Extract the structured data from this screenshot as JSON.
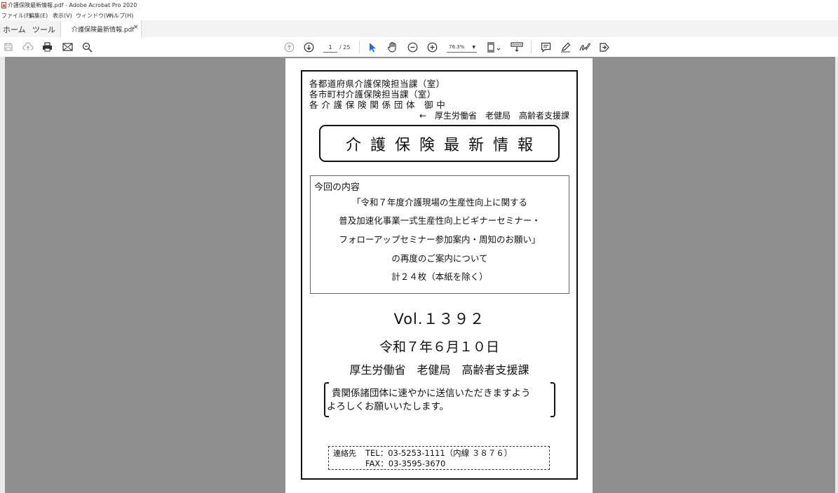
{
  "window": {
    "title": "介護保険最新情報.pdf - Adobe Acrobat Pro 2020"
  },
  "menu": [
    "ファイル(F)",
    "編集(E)",
    "表示(V)",
    "ウィンドウ(W)",
    "ヘルプ(H)"
  ],
  "tabs": {
    "home": "ホーム",
    "tools": "ツール",
    "document": "介護保険最新情報.pdf",
    "close": "×"
  },
  "toolbar": {
    "icons": [
      "save-icon",
      "upload-icon",
      "print-icon",
      "mail-icon",
      "zoom-search-icon",
      "prev-page-icon",
      "next-page-icon",
      "select-cursor-icon",
      "hand-icon",
      "zoom-out-icon",
      "zoom-in-icon",
      "fit-page-icon",
      "scroll-mode-icon",
      "comment-icon",
      "pen-icon",
      "sign-icon",
      "share-icon"
    ],
    "current_page": "1",
    "total_pages": "/ 25",
    "zoom": "76.3%",
    "accent": "#1473e6"
  },
  "document": {
    "recipients": [
      "各都道府県介護保険担当課（室）",
      "各市町村介護保険担当課（室）",
      "各 介 護 保 険 関 係 団 体　御 中"
    ],
    "sender": "←　厚生労働省　老健局　高齢者支援課",
    "banner": "介護保険最新情報",
    "contents": {
      "heading": "今回の内容",
      "lines": [
        "「令和７年度介護現場の生産性向上に関する",
        "普及加速化事業一式生産性向上ビギナーセミナー・",
        "フォローアップセミナー参加案内・周知のお願い」",
        "の再度のご案内について",
        "計２４枚（本紙を除く）"
      ]
    },
    "volume": "Vol.１３９２",
    "date": "令和７年６月１０日",
    "bureau": "厚生労働省　老健局　高齢者支援課",
    "request": [
      "貴関係諸団体に速やかに送信いただきますよう",
      "よろしくお願いいたします。"
    ],
    "contact": {
      "label": "連絡先",
      "tel": "TEL：03-5253-1111（内線 ３８７６）",
      "fax": "FAX：03-3595-3670"
    }
  }
}
